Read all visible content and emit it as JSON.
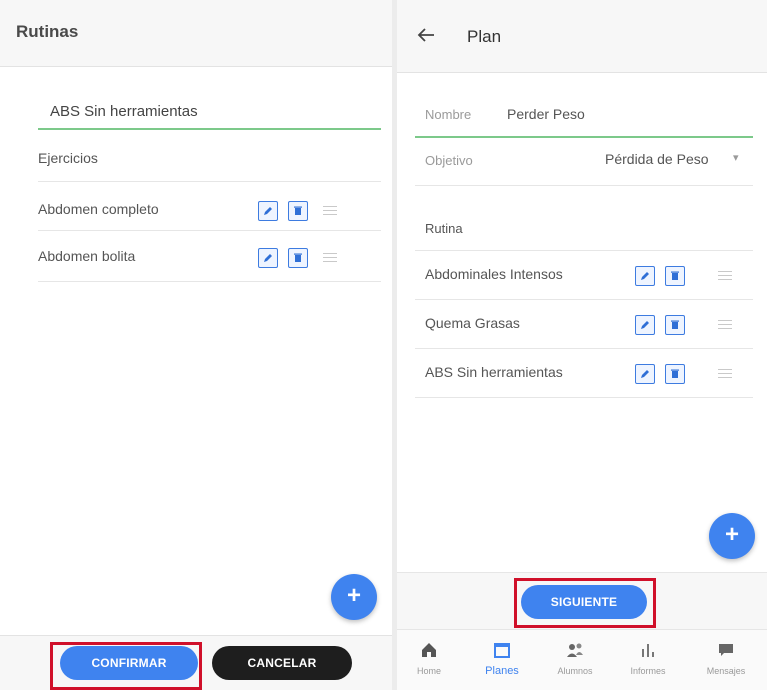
{
  "left": {
    "title": "Rutinas",
    "routine_name": "ABS Sin herramientas",
    "section_label": "Ejercicios",
    "exercises": [
      {
        "name": "Abdomen completo"
      },
      {
        "name": "Abdomen bolita"
      }
    ],
    "fab_label": "+",
    "confirm_label": "CONFIRMAR",
    "cancel_label": "CANCELAR"
  },
  "right": {
    "title": "Plan",
    "name_label": "Nombre",
    "name_value": "Perder Peso",
    "objective_label": "Objetivo",
    "objective_value": "Pérdida de Peso",
    "dropdown_caret": "▾",
    "section_label": "Rutina",
    "routines": [
      {
        "name": "Abdominales Intensos"
      },
      {
        "name": "Quema Grasas"
      },
      {
        "name": "ABS Sin herramientas"
      }
    ],
    "fab_label": "+",
    "next_label": "SIGUIENTE",
    "nav": [
      {
        "label": "Home",
        "icon": "home-icon",
        "active": false
      },
      {
        "label": "Planes",
        "icon": "calendar-icon",
        "active": true
      },
      {
        "label": "Alumnos",
        "icon": "people-icon",
        "active": false
      },
      {
        "label": "Informes",
        "icon": "bar-chart-icon",
        "active": false
      },
      {
        "label": "Mensajes",
        "icon": "chat-icon",
        "active": false
      }
    ]
  },
  "colors": {
    "accent": "#3f83ef",
    "highlight_box": "#d0102a",
    "field_underline": "#7cc98a"
  }
}
